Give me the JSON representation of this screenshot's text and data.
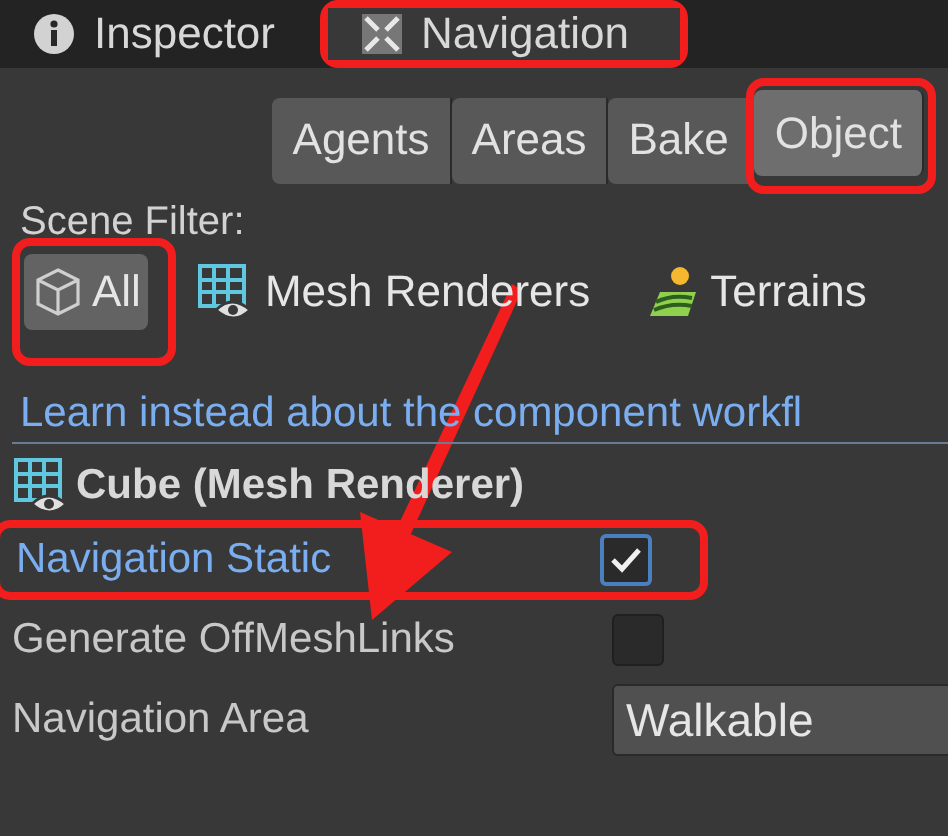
{
  "tabs": [
    {
      "label": "Inspector",
      "selected": false,
      "annotated": false
    },
    {
      "label": "Navigation",
      "selected": true,
      "annotated": true
    }
  ],
  "subtabs": [
    {
      "label": "Agents",
      "selected": false,
      "annotated": false
    },
    {
      "label": "Areas",
      "selected": false,
      "annotated": false
    },
    {
      "label": "Bake",
      "selected": false,
      "annotated": false
    },
    {
      "label": "Object",
      "selected": true,
      "annotated": true
    }
  ],
  "scene_filter": {
    "label": "Scene Filter:",
    "options": [
      {
        "label": "All",
        "selected": true,
        "annotated": true
      },
      {
        "label": "Mesh Renderers",
        "selected": false,
        "annotated": false
      },
      {
        "label": "Terrains",
        "selected": false,
        "annotated": false
      }
    ]
  },
  "link": "Learn instead about the component workfl",
  "object": {
    "title": "Cube (Mesh Renderer)"
  },
  "fields": [
    {
      "kind": "checkbox",
      "label": "Navigation Static",
      "checked": true,
      "focused": true,
      "annotated": true
    },
    {
      "kind": "checkbox",
      "label": "Generate OffMeshLinks",
      "checked": false,
      "focused": false,
      "annotated": false
    },
    {
      "kind": "dropdown",
      "label": "Navigation Area",
      "value": "Walkable",
      "focused": false,
      "annotated": false
    }
  ],
  "pointer_arrow": true
}
